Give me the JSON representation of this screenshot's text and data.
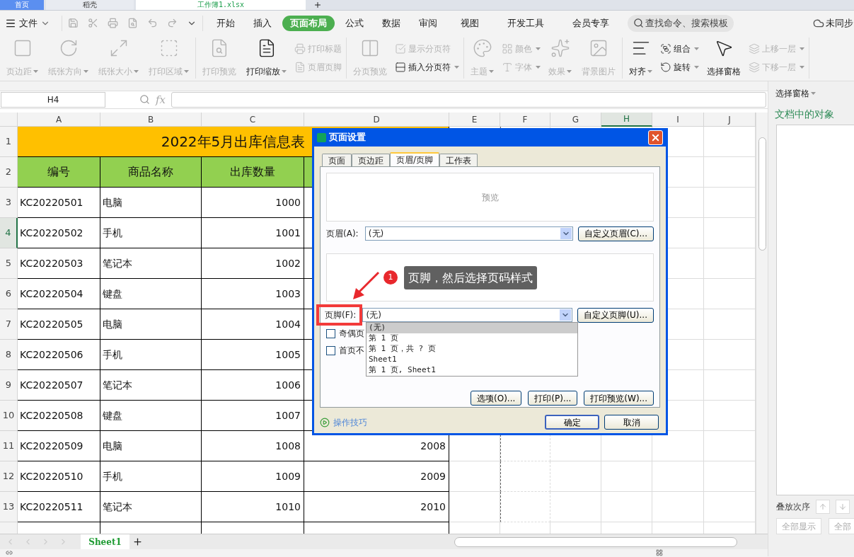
{
  "app_tabs": [
    {
      "label": "首页",
      "selected": false
    },
    {
      "label": "稻壳",
      "selected": false
    },
    {
      "label": "工作簿1.xlsx",
      "selected": true
    }
  ],
  "menu": {
    "file": "文件",
    "tabs": [
      {
        "label": "开始",
        "selected": false
      },
      {
        "label": "插入",
        "selected": false
      },
      {
        "label": "页面布局",
        "selected": true
      },
      {
        "label": "公式",
        "selected": false
      },
      {
        "label": "数据",
        "selected": false
      },
      {
        "label": "审阅",
        "selected": false
      },
      {
        "label": "视图",
        "selected": false
      },
      {
        "label": "开发工具",
        "selected": false
      },
      {
        "label": "会员专享",
        "selected": false
      }
    ],
    "search": {
      "placeholder": "查找命令、搜索模板"
    },
    "sync": "未同步"
  },
  "ribbon": {
    "groups": [
      {
        "items": [
          {
            "kind": "large",
            "label": "页边距",
            "disabled": true,
            "dropdown": true
          },
          {
            "kind": "large",
            "label": "纸张方向",
            "disabled": true,
            "dropdown": true
          },
          {
            "kind": "large",
            "label": "纸张大小",
            "disabled": true,
            "dropdown": true
          },
          {
            "kind": "large",
            "label": "打印区域",
            "disabled": true,
            "dropdown": true
          }
        ]
      },
      {
        "items": [
          {
            "kind": "large",
            "label": "打印预览",
            "disabled": true,
            "dropdown": false
          },
          {
            "kind": "large",
            "label": "打印缩放",
            "disabled": false,
            "dropdown": true
          },
          {
            "kind": "stack",
            "children": [
              {
                "label": "打印标题",
                "disabled": true,
                "dropdown": false
              },
              {
                "label": "页眉页脚",
                "disabled": true,
                "dropdown": false
              }
            ]
          }
        ]
      },
      {
        "items": [
          {
            "kind": "large",
            "label": "分页预览",
            "disabled": true,
            "dropdown": false
          },
          {
            "kind": "stack",
            "children": [
              {
                "label": "显示分页符",
                "disabled": true,
                "dropdown": false
              },
              {
                "label": "插入分页符",
                "disabled": false,
                "dropdown": true
              }
            ]
          }
        ]
      },
      {
        "items": [
          {
            "kind": "large",
            "label": "主题",
            "disabled": true,
            "dropdown": true
          },
          {
            "kind": "stack",
            "children": [
              {
                "label": "颜色",
                "disabled": true,
                "dropdown": true
              },
              {
                "label": "字体",
                "disabled": true,
                "dropdown": true
              }
            ]
          },
          {
            "kind": "large",
            "label": "效果",
            "disabled": true,
            "dropdown": true
          },
          {
            "kind": "large",
            "label": "背景图片",
            "disabled": true,
            "dropdown": false
          }
        ]
      },
      {
        "items": [
          {
            "kind": "large",
            "label": "对齐",
            "disabled": false,
            "dropdown": true
          },
          {
            "kind": "stack",
            "children": [
              {
                "label": "组合",
                "disabled": false,
                "dropdown": true
              },
              {
                "label": "旋转",
                "disabled": false,
                "dropdown": true
              }
            ]
          },
          {
            "kind": "large",
            "label": "选择窗格",
            "disabled": false,
            "dropdown": false
          },
          {
            "kind": "stack",
            "children": [
              {
                "label": "上移一层",
                "disabled": true,
                "dropdown": true
              },
              {
                "label": "下移一层",
                "disabled": true,
                "dropdown": true
              }
            ]
          }
        ]
      }
    ]
  },
  "formula_bar": {
    "name_box": "H4",
    "fx": "fx"
  },
  "sheet": {
    "columns": [
      {
        "label": "A",
        "selected": false
      },
      {
        "label": "B",
        "selected": false
      },
      {
        "label": "C",
        "selected": false
      },
      {
        "label": "D",
        "selected": false
      },
      {
        "label": "E",
        "selected": false
      },
      {
        "label": "F",
        "selected": false
      },
      {
        "label": "G",
        "selected": false
      },
      {
        "label": "H",
        "selected": true
      },
      {
        "label": "I",
        "selected": false
      },
      {
        "label": "J",
        "selected": false
      }
    ],
    "rows": [
      {
        "number": "1",
        "selected": false,
        "kind": "title",
        "title": "2022年5月出库信息表"
      },
      {
        "number": "2",
        "selected": false,
        "kind": "header",
        "cells": [
          "编号",
          "商品名称",
          "出库数量"
        ]
      },
      {
        "number": "3",
        "selected": false,
        "kind": "data",
        "cells": [
          "KC20220501",
          "电脑",
          "1000"
        ]
      },
      {
        "number": "4",
        "selected": true,
        "kind": "data",
        "cells": [
          "KC20220502",
          "手机",
          "1001"
        ]
      },
      {
        "number": "5",
        "selected": false,
        "kind": "data",
        "cells": [
          "KC20220503",
          "笔记本",
          "1002"
        ]
      },
      {
        "number": "6",
        "selected": false,
        "kind": "data",
        "cells": [
          "KC20220504",
          "键盘",
          "1003"
        ]
      },
      {
        "number": "7",
        "selected": false,
        "kind": "data",
        "cells": [
          "KC20220505",
          "电脑",
          "1004"
        ]
      },
      {
        "number": "8",
        "selected": false,
        "kind": "data",
        "cells": [
          "KC20220506",
          "手机",
          "1005"
        ]
      },
      {
        "number": "9",
        "selected": false,
        "kind": "data",
        "cells": [
          "KC20220507",
          "笔记本",
          "1006"
        ]
      },
      {
        "number": "10",
        "selected": false,
        "kind": "data",
        "cells": [
          "KC20220508",
          "键盘",
          "1007"
        ]
      },
      {
        "number": "11",
        "selected": false,
        "kind": "data",
        "cells": [
          "KC20220509",
          "电脑",
          "1008",
          "2008"
        ]
      },
      {
        "number": "12",
        "selected": false,
        "kind": "data",
        "cells": [
          "KC20220510",
          "手机",
          "1009",
          "2009"
        ]
      },
      {
        "number": "13",
        "selected": false,
        "kind": "data",
        "cells": [
          "KC20220511",
          "笔记本",
          "1010",
          "2010"
        ]
      }
    ]
  },
  "sheet_tabs": [
    {
      "label": "Sheet1",
      "selected": true
    }
  ],
  "pane": {
    "title": "选择窗格",
    "heading": "文档中的对象",
    "order_label": "叠放次序",
    "buttons": [
      "全部显示",
      "全部"
    ]
  },
  "dialog": {
    "title": "页面设置",
    "tabs": [
      {
        "label": "页面",
        "selected": false
      },
      {
        "label": "页边距",
        "selected": false
      },
      {
        "label": "页眉/页脚",
        "selected": true
      },
      {
        "label": "工作表",
        "selected": false
      }
    ],
    "preview": "预览",
    "header": {
      "label": "页眉(A):",
      "value": "(无)",
      "button": "自定义页眉(C)..."
    },
    "footer": {
      "label": "页脚(F):",
      "value": "(无)",
      "button": "自定义页脚(U)...",
      "highlighted": true,
      "options": [
        {
          "label": "(无)",
          "selected": true
        },
        {
          "label": "第 1 页",
          "selected": false
        },
        {
          "label": "第 1 页，共 ? 页",
          "selected": false
        },
        {
          "label": "Sheet1",
          "selected": false
        },
        {
          "label": "第 1 页, Sheet1",
          "selected": false
        }
      ]
    },
    "callout": {
      "number": "1",
      "text": "页脚，然后选择页码样式"
    },
    "checkboxes": [
      {
        "label": "奇偶页",
        "checked": false
      },
      {
        "label": "首页不",
        "checked": false
      }
    ],
    "buttons": [
      "选项(O)...",
      "打印(P)...",
      "打印预览(W)..."
    ],
    "tips": "操作技巧",
    "ok": "确定",
    "cancel": "取消"
  }
}
